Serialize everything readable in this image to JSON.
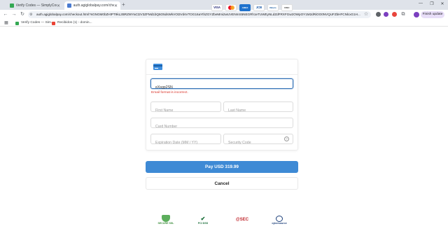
{
  "browser": {
    "tabs": [
      {
        "label": "Verify Codes — SimplyCodes",
        "active": false
      },
      {
        "label": "auth.agiglobalpay.com/checkout...",
        "active": true
      }
    ],
    "url": "auth.agiglobalpay.com/checkout.html?sGNGM0bZHtPT9kL2BRZWYaCt2V3ZFMd1bQ6O5dsWkVOt3VdsVTOG16aYthZGYZbeMmi2wUVENmS5NEGRh1eTUWEyNLdZdFRXFGw2OWpOY1M2dRiOO0NVQUFZbHFCNlcxG1H...",
    "bookmarks": [
      {
        "label": "Verify Codes — Sim...",
        "color": "#34a853"
      },
      {
        "label": "Recibidos (1) - domin...",
        "color": "#ea4335"
      }
    ],
    "profile_label": "Finish update"
  },
  "checkout": {
    "brands": [
      "VISA",
      "mastercard",
      "AMERICAN EXPRESS",
      "JCB",
      "Diners Club",
      "DISCOVER"
    ],
    "email_value": "eXsgp2SN",
    "email_error": "Email format is incorrect.",
    "first_name_placeholder": "First Name",
    "last_name_placeholder": "Last Name",
    "card_number_placeholder": "Card Number",
    "expiration_placeholder": "Expiration Date (MM / YY)",
    "security_code_placeholder": "Security Code",
    "pay_label": "Pay USD 319.99",
    "cancel_label": "Cancel"
  },
  "trust_badges": [
    "SECURE SSL",
    "PCI DSS",
    "@SEC",
    "cybersource"
  ],
  "colors": {
    "accent": "#3e8ad5",
    "error": "#d93025"
  }
}
